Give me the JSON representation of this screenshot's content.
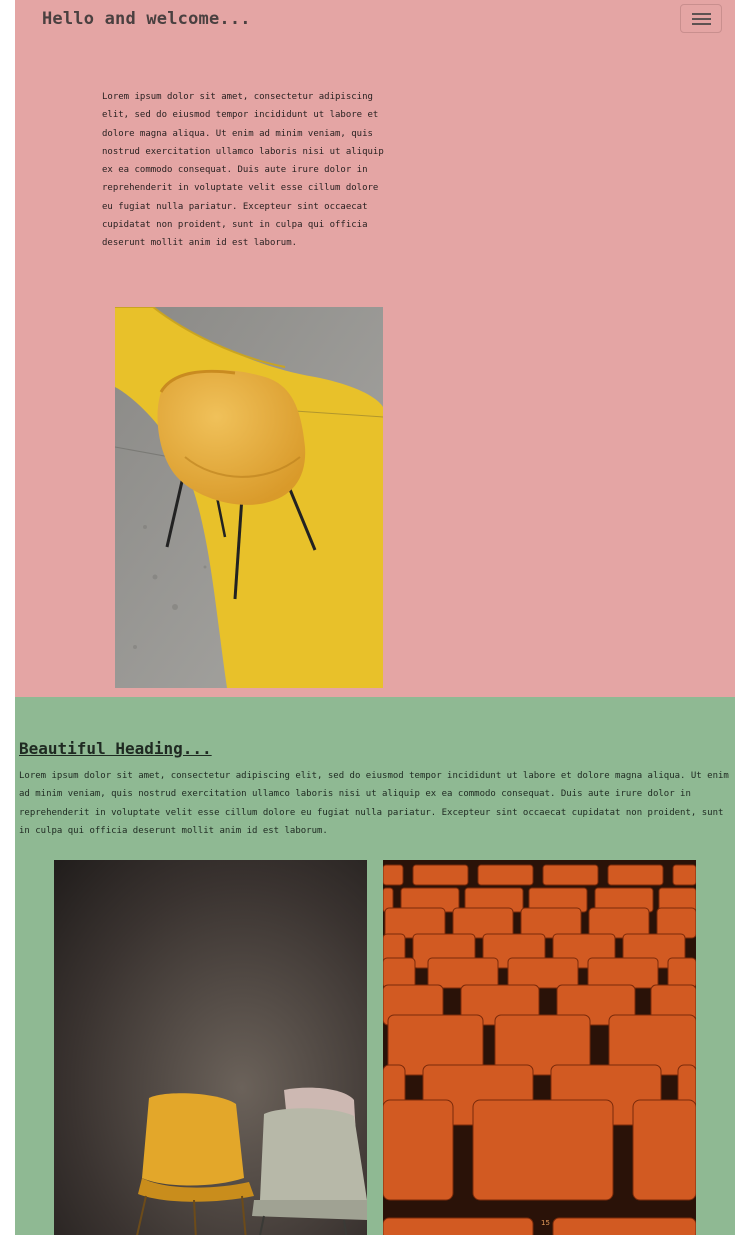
{
  "brand": "Hello and welcome...",
  "intro_text": "Lorem ipsum dolor sit amet, consectetur adipiscing elit, sed do eiusmod tempor incididunt ut labore et dolore magna aliqua. Ut enim ad minim veniam, quis nostrud exercitation ullamco laboris nisi ut aliquip ex ea commodo consequat. Duis aute irure dolor in reprehenderit in voluptate velit esse cillum dolore eu fugiat nulla pariatur. Excepteur sint occaecat cupidatat non proident, sunt in culpa qui officia deserunt mollit anim id est laborum.",
  "section": {
    "heading": "Beautiful Heading...",
    "text": "Lorem ipsum dolor sit amet, consectetur adipiscing elit, sed do eiusmod tempor incididunt ut labore et dolore magna aliqua. Ut enim ad minim veniam, quis nostrud exercitation ullamco laboris nisi ut aliquip ex ea commodo consequat. Duis aute irure dolor in reprehenderit in voluptate velit esse cillum dolore eu fugiat nulla pariatur. Excepteur sint occaecat cupidatat non proident, sunt in culpa qui officia deserunt mollit anim id est laborum."
  },
  "theater_seat_number": "15",
  "icons": {
    "menu": "hamburger-menu-icon"
  },
  "colors": {
    "top_section_bg": "#e4a5a4",
    "bottom_section_bg": "#8fb993",
    "yellow_paint": "#e8c12a",
    "seat_orange": "#c24a14"
  }
}
